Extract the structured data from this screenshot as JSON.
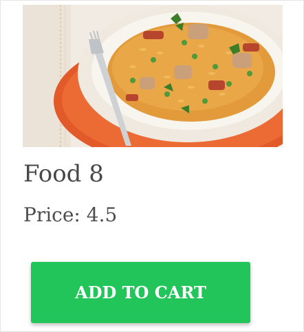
{
  "card": {
    "image_alt": "food-photo",
    "title": "Food 8",
    "price_label": "Price:",
    "price_value": "4.5",
    "button_label": "ADD TO CART"
  },
  "colors": {
    "button_bg": "#22c55a",
    "button_text": "#ffffff",
    "title_text": "#474747"
  }
}
